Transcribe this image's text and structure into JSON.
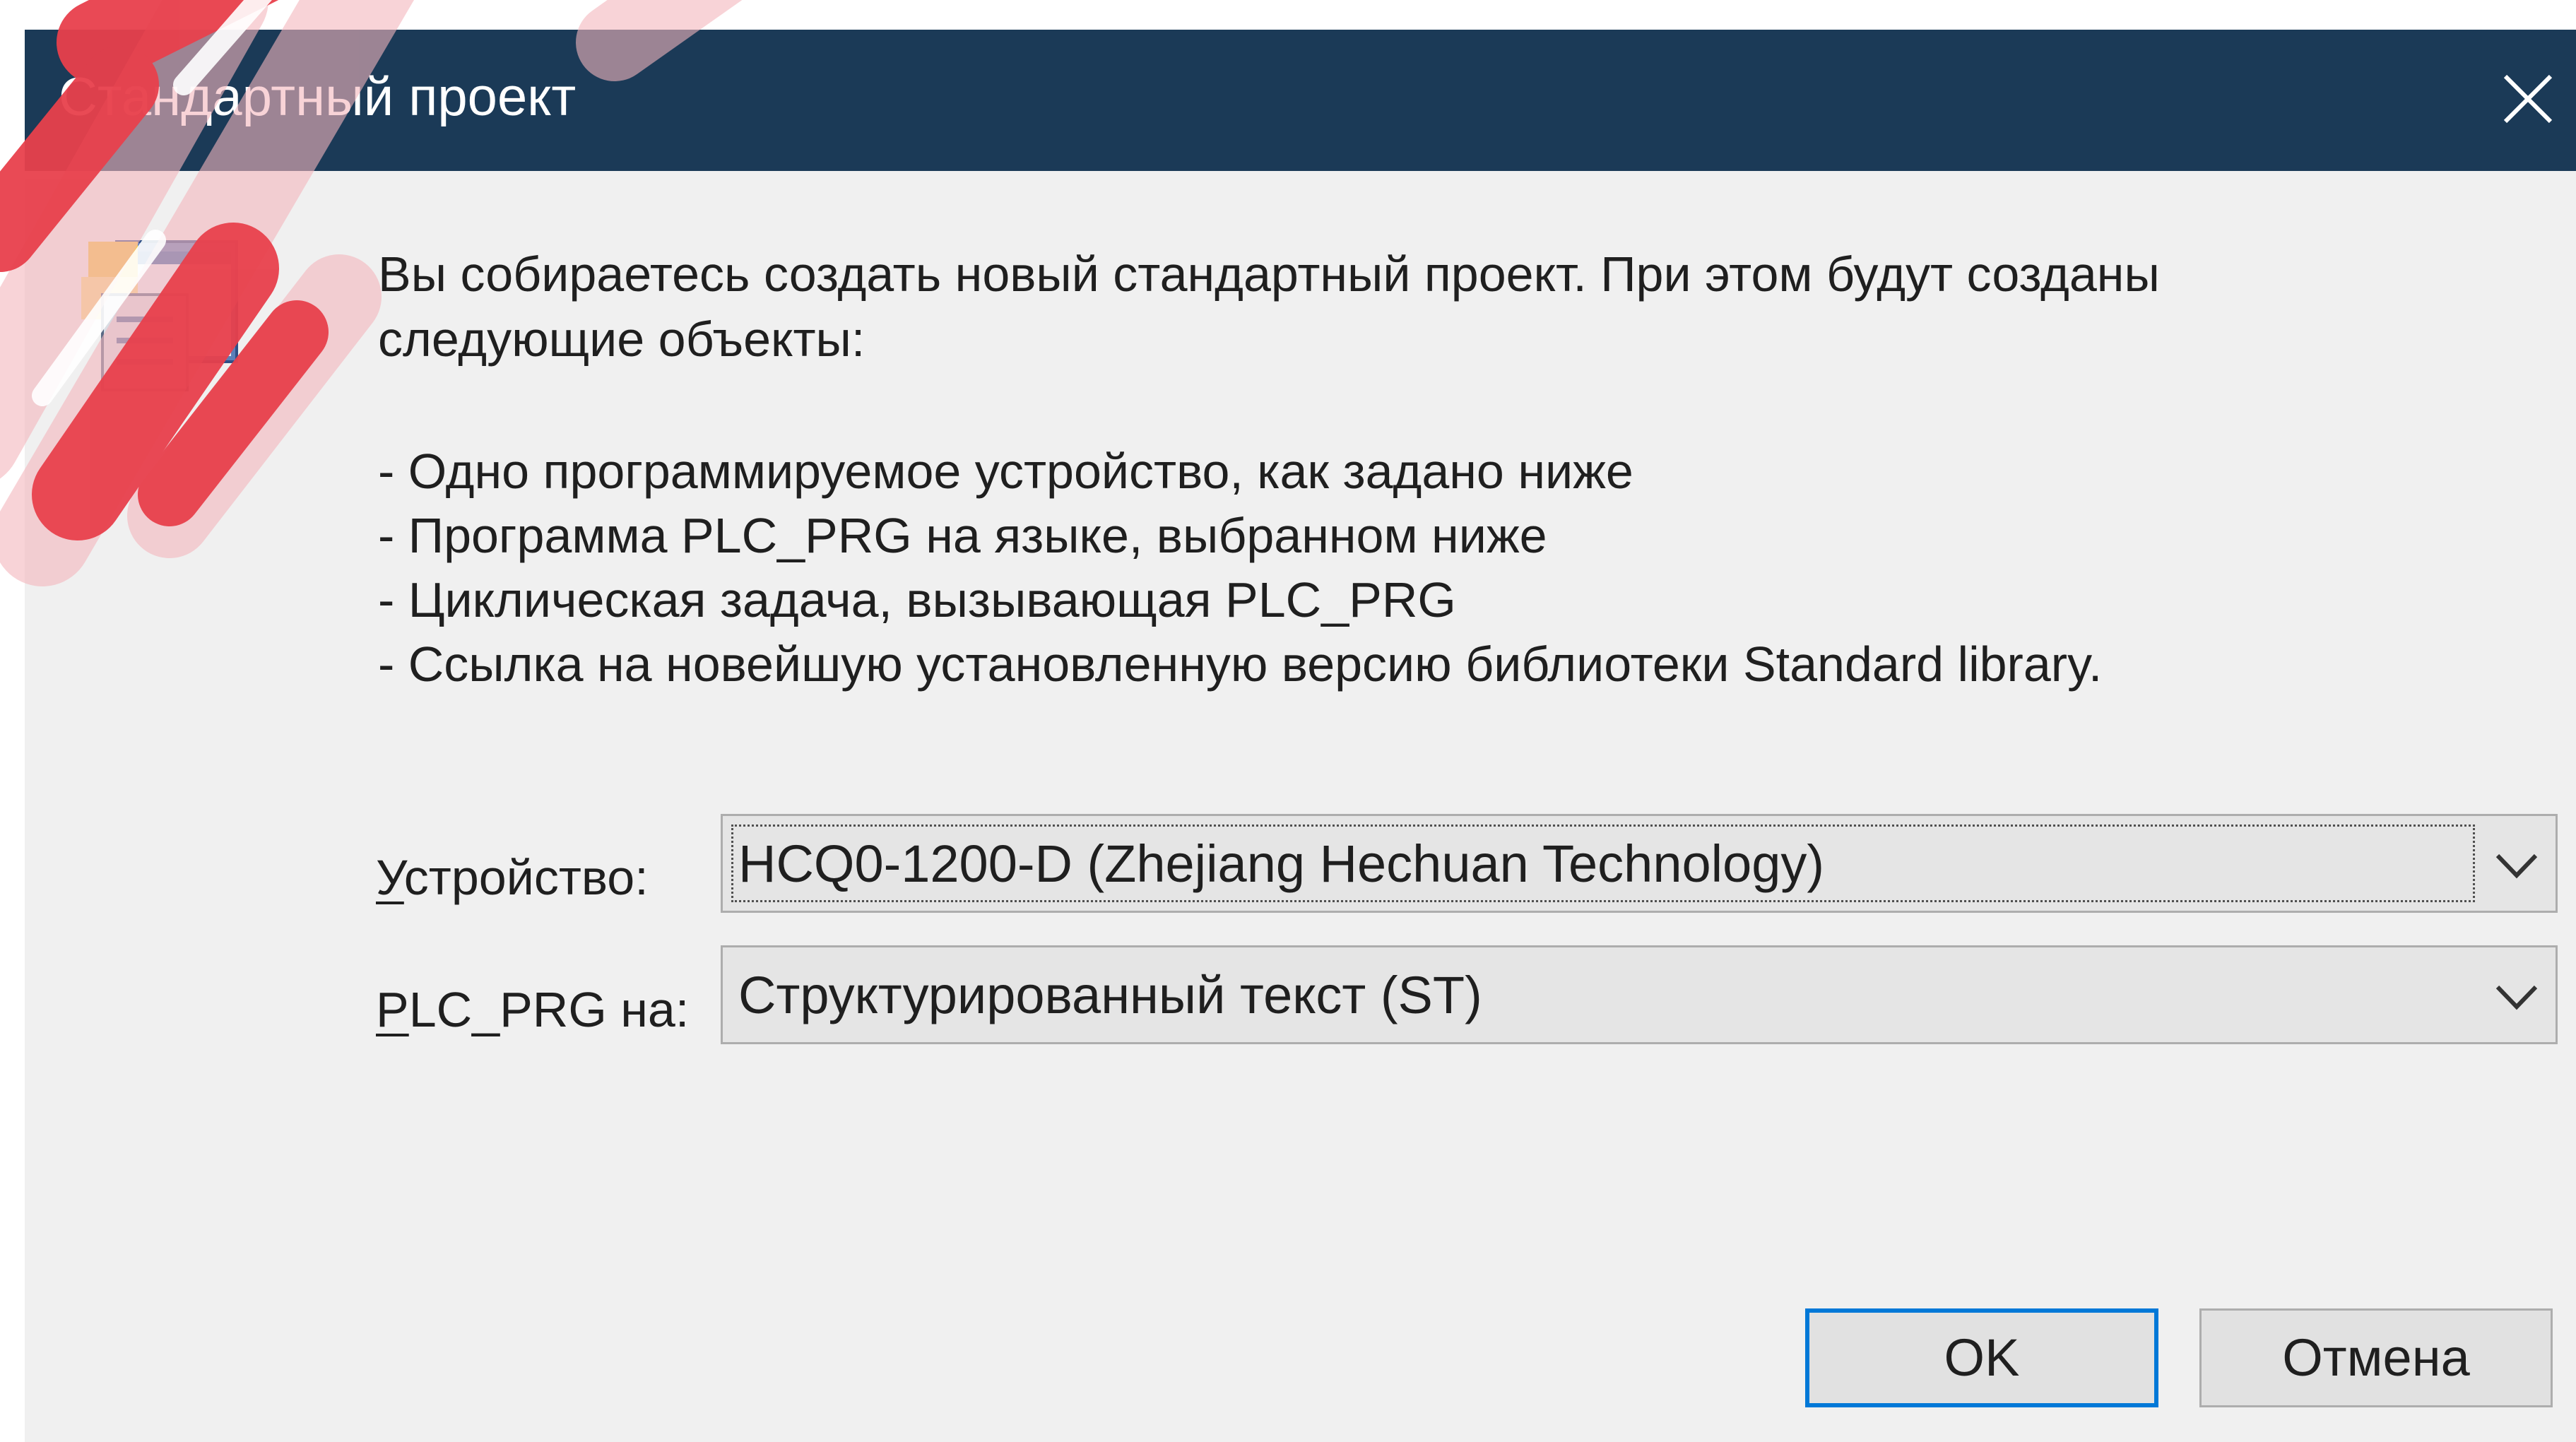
{
  "dialog": {
    "title": "Стандартный проект",
    "intro_line1": "Вы собираетесь создать новый стандартный проект. При этом будут созданы",
    "intro_line2": "следующие объекты:",
    "bullets": [
      "- Одно программируемое устройство, как задано ниже",
      "- Программа PLC_PRG на языке, выбранном ниже",
      "- Циклическая задача, вызывающая PLC_PRG",
      "- Ссылка на новейшую установленную версию библиотеки Standard library."
    ]
  },
  "device": {
    "label_mnemonic": "У",
    "label_rest": "стройство:",
    "value": "HCQ0-1200-D (Zhejiang Hechuan Technology)"
  },
  "language": {
    "label_mnemonic": "P",
    "label_rest": "LC_PRG на:",
    "value": "Структурированный текст (ST)"
  },
  "buttons": {
    "ok": "OK",
    "cancel": "Отмена"
  },
  "colors": {
    "titlebar": "#1b3a57",
    "dialog_bg": "#f0f0f0",
    "accent": "#0078d7",
    "watermark": "#e8404c"
  },
  "icons": {
    "close": "close-icon",
    "app": "standard-project-icon",
    "dropdown": "chevron-down-icon"
  }
}
